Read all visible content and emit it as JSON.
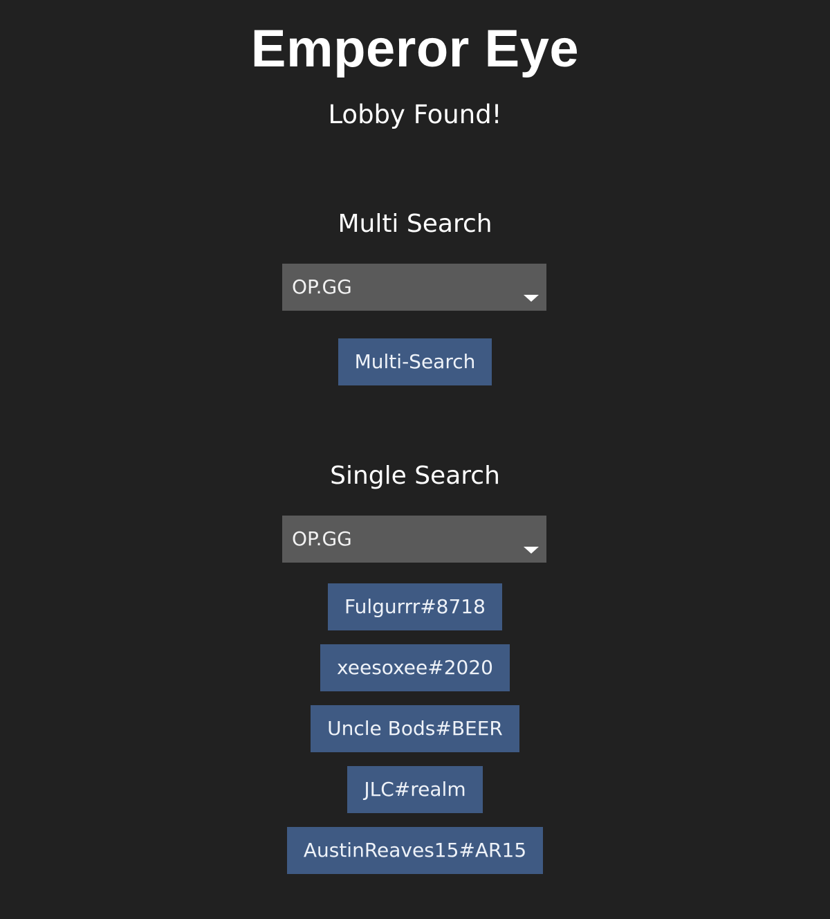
{
  "app": {
    "title": "Emperor Eye",
    "status": "Lobby Found!"
  },
  "multi_search": {
    "heading": "Multi Search",
    "site_select": {
      "selected": "OP.GG"
    },
    "button_label": "Multi-Search"
  },
  "single_search": {
    "heading": "Single Search",
    "site_select": {
      "selected": "OP.GG"
    },
    "players": [
      "Fulgurrr#8718",
      "xeesoxee#2020",
      "Uncle Bods#BEER",
      "JLC#realm",
      "AustinReaves15#AR15"
    ]
  },
  "colors": {
    "background": "#212121",
    "select_background": "#5a5a5a",
    "button_background": "#3f5a83",
    "text": "#ffffff"
  }
}
